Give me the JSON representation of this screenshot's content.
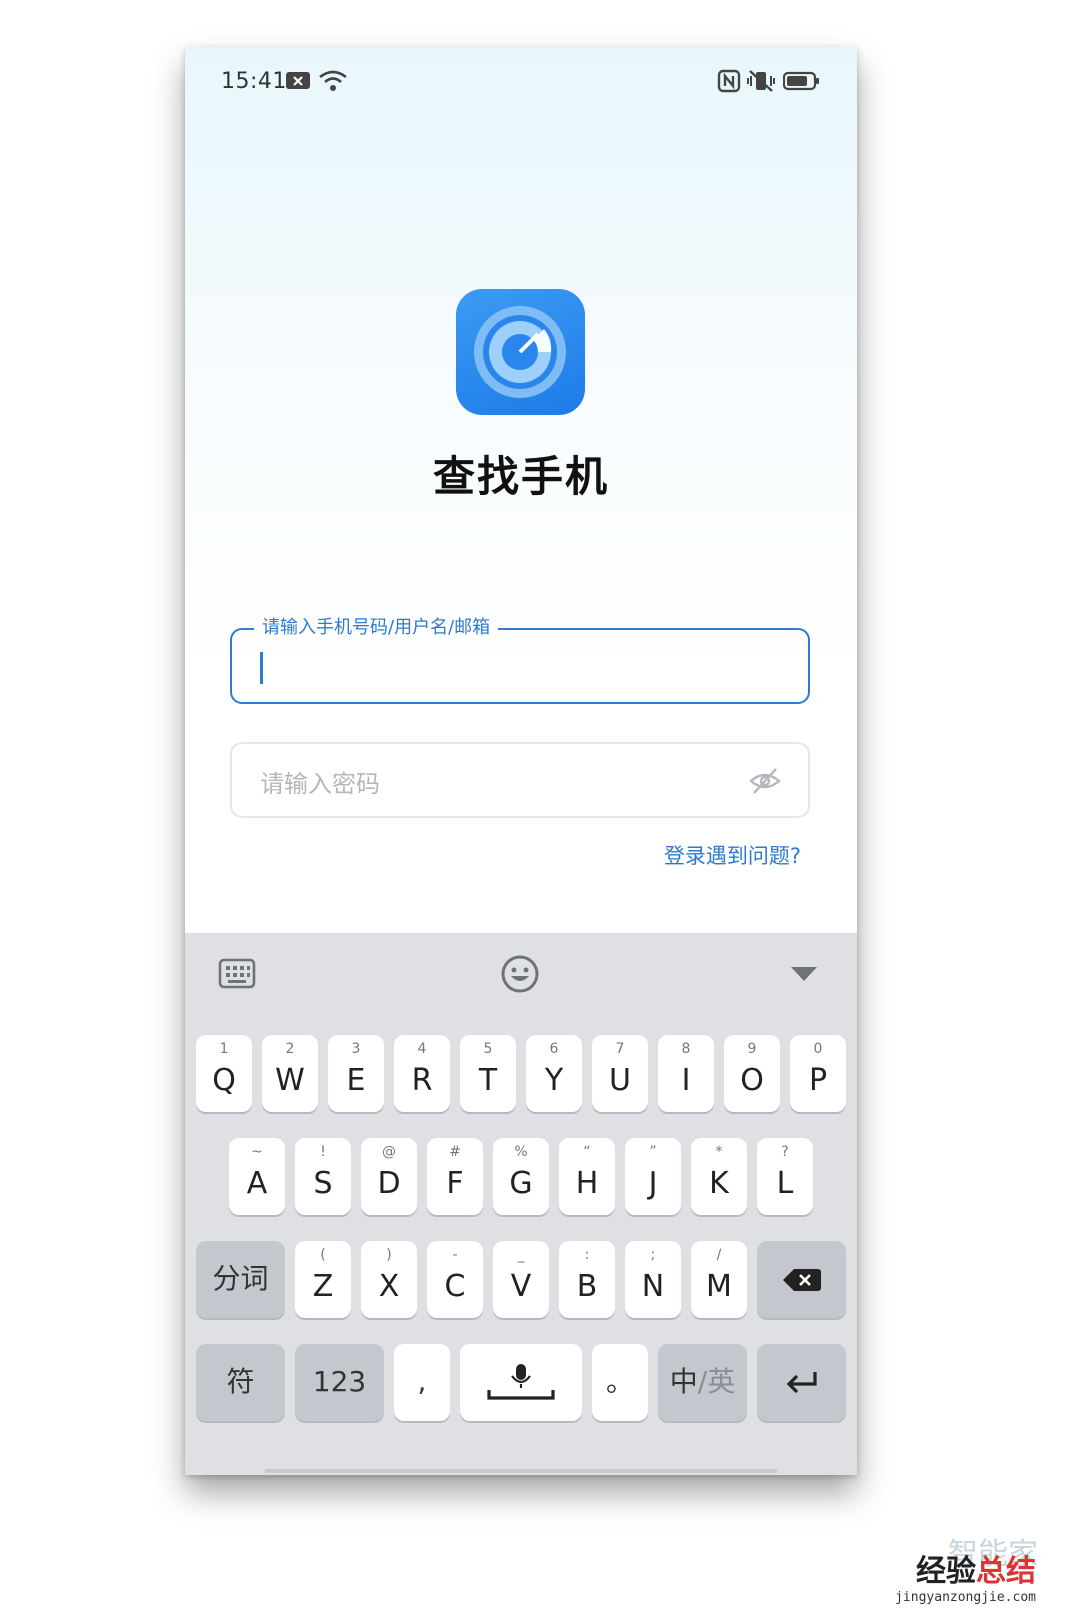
{
  "status_bar": {
    "time": "15:41",
    "icons": [
      "notification-x-icon",
      "wifi-icon",
      "nfc-icon",
      "vibrate-mute-icon",
      "battery-icon"
    ]
  },
  "app": {
    "title": "查找手机",
    "icon": "radar-icon",
    "accent_color": "#2f7ad0"
  },
  "login_form": {
    "account_label": "请输入手机号码/用户名/邮箱",
    "password_placeholder": "请输入密码",
    "help_link": "登录遇到问题?"
  },
  "keyboard": {
    "toolbar": [
      "keyboard-icon",
      "emoji-icon",
      "collapse-icon"
    ],
    "row1": [
      {
        "sub": "1",
        "key": "Q"
      },
      {
        "sub": "2",
        "key": "W"
      },
      {
        "sub": "3",
        "key": "E"
      },
      {
        "sub": "4",
        "key": "R"
      },
      {
        "sub": "5",
        "key": "T"
      },
      {
        "sub": "6",
        "key": "Y"
      },
      {
        "sub": "7",
        "key": "U"
      },
      {
        "sub": "8",
        "key": "I"
      },
      {
        "sub": "9",
        "key": "O"
      },
      {
        "sub": "0",
        "key": "P"
      }
    ],
    "row2": [
      {
        "sub": "~",
        "key": "A"
      },
      {
        "sub": "!",
        "key": "S"
      },
      {
        "sub": "@",
        "key": "D"
      },
      {
        "sub": "#",
        "key": "F"
      },
      {
        "sub": "%",
        "key": "G"
      },
      {
        "sub": "“",
        "key": "H"
      },
      {
        "sub": "”",
        "key": "J"
      },
      {
        "sub": "*",
        "key": "K"
      },
      {
        "sub": "?",
        "key": "L"
      }
    ],
    "row3_left": "分词",
    "row3": [
      {
        "sub": "(",
        "key": "Z"
      },
      {
        "sub": ")",
        "key": "X"
      },
      {
        "sub": "-",
        "key": "C"
      },
      {
        "sub": "_",
        "key": "V"
      },
      {
        "sub": ":",
        "key": "B"
      },
      {
        "sub": ";",
        "key": "N"
      },
      {
        "sub": "/",
        "key": "M"
      }
    ],
    "row4": {
      "symbol": "符",
      "numbers": "123",
      "comma": ",",
      "period": "。",
      "lang_cn": "中",
      "lang_en": "/英"
    }
  },
  "watermark": {
    "faint": "智能家",
    "title_black": "经验",
    "title_red": "总结",
    "url": "jingyanzongjie.com"
  }
}
